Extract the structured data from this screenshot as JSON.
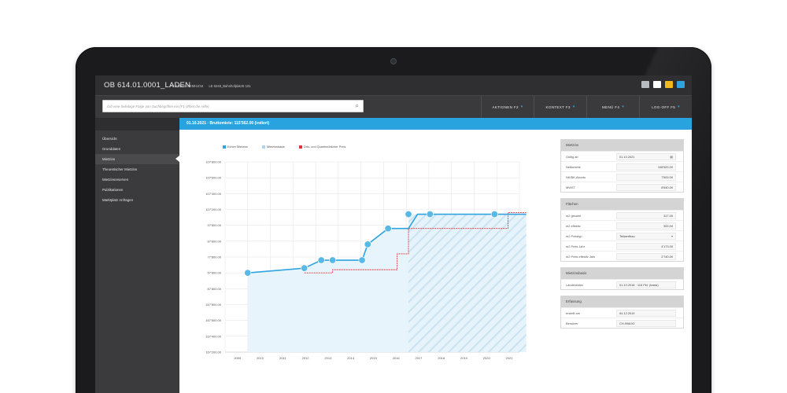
{
  "app": {
    "title": "OB 614.01.0001_LADEN",
    "meta": [
      "PE 834429 REMHJ/44",
      "LE 6248_BahnhofplatzE 101"
    ],
    "icons": [
      "mail-icon",
      "chat-icon",
      "note-icon",
      "help-icon"
    ]
  },
  "search": {
    "placeholder": "Gib eine beliebige Folge von Suchbegriffen ein (F1 öffnet die Hilfe)"
  },
  "menus": [
    {
      "label": "AKTIONEN F2"
    },
    {
      "label": "KONTEXT F3"
    },
    {
      "label": "MENÜ F4"
    },
    {
      "label": "LOG-OFF F5"
    }
  ],
  "sidebar": {
    "items": [
      {
        "label": "Übersicht"
      },
      {
        "label": "Grunddaten"
      },
      {
        "label": "Mietzins",
        "active": true
      },
      {
        "label": "Theoretischer Mietzins"
      },
      {
        "label": "Mietzinsreserven"
      },
      {
        "label": "Publikationen"
      },
      {
        "label": "Marktplatz Anfragen"
      }
    ]
  },
  "header": {
    "text": "01.10.2021 · Bruttomiete: 115'562.00 (indiert)"
  },
  "legend": [
    {
      "label": "Echter Mietzins",
      "color": "#2fa3e0"
    },
    {
      "label": "Mietzinsbasis",
      "color": "#a9d7ef"
    },
    {
      "label": "Orts- und Quartierüblicher Preis",
      "color": "#e0303a"
    }
  ],
  "chart_data": {
    "type": "line",
    "x_ticks": [
      "2009",
      "2010",
      "2011",
      "2012",
      "2013",
      "2014",
      "2015",
      "2016",
      "2017",
      "2018",
      "2019",
      "2020",
      "2021"
    ],
    "y_ticks": [
      "107'800.00",
      "107'600.00",
      "107'400.00",
      "107'200.00",
      "97'800.00",
      "87'800.00",
      "77'800.00",
      "57'800.00",
      "87'800.00",
      "167'800.00",
      "167'600.00",
      "167'400.00",
      "167'200.00"
    ],
    "ylim": [
      0,
      12
    ],
    "grid": true,
    "series": [
      {
        "name": "Echter Mietzins",
        "points": [
          [
            2009.0,
            5
          ],
          [
            2011.5,
            5.3
          ],
          [
            2012.25,
            5.8
          ],
          [
            2012.75,
            5.8
          ],
          [
            2014.05,
            5.8
          ],
          [
            2014.3,
            6.8
          ],
          [
            2015.2,
            7.8
          ],
          [
            2016.1,
            7.8
          ],
          [
            2016.5,
            8.7
          ],
          [
            2019.4,
            8.7
          ],
          [
            2021.3,
            8.7
          ]
        ],
        "markers": [
          [
            2009.0,
            5
          ],
          [
            2011.5,
            5.3
          ],
          [
            2012.25,
            5.8
          ],
          [
            2012.75,
            5.8
          ],
          [
            2014.05,
            5.8
          ],
          [
            2014.3,
            6.8
          ],
          [
            2015.2,
            7.8
          ],
          [
            2016.1,
            8.7
          ],
          [
            2017.05,
            8.7
          ],
          [
            2019.9,
            8.7
          ]
        ]
      },
      {
        "name": "Orts- und Quartierüblicher Preis",
        "points": [
          [
            2011.5,
            5.0
          ],
          [
            2012.75,
            5.0
          ],
          [
            2012.75,
            5.2
          ],
          [
            2015.6,
            5.2
          ],
          [
            2015.6,
            6.2
          ],
          [
            2016.1,
            6.2
          ],
          [
            2016.1,
            7.8
          ],
          [
            2020.5,
            7.8
          ],
          [
            2020.5,
            8.8
          ],
          [
            2021.3,
            8.8
          ]
        ]
      }
    ]
  },
  "panels": [
    {
      "title": "Mietzins",
      "rows": [
        {
          "label": "Gültig ab",
          "value": "01.10.2021",
          "icon": "calendar-icon"
        },
        {
          "label": "Nettomiete",
          "value": "108'500.00"
        },
        {
          "label": "NK/BK-Akonto",
          "value": "7'500.00"
        },
        {
          "label": "MWST",
          "value": "8'540.00"
        }
      ]
    },
    {
      "title": "Flächen",
      "rows": [
        {
          "label": "m2 gesamt",
          "value": "317.00"
        },
        {
          "label": "m2 effektiv",
          "value": "300.00"
        },
        {
          "label": "m2 Preistyp",
          "value": "Teilwertbau",
          "icon": "chevron-down-icon"
        },
        {
          "label": "m2 Preis Jahr",
          "value": "4'173.00"
        },
        {
          "label": "m2 Preis effektiv Jahr",
          "value": "2'740.00"
        }
      ]
    },
    {
      "title": "Mietzinsbasis",
      "rows": [
        {
          "label": "Landesindex",
          "value": "01.10.2018 · 116 Pkt. (basis)"
        }
      ]
    },
    {
      "title": "Erfassung",
      "rows": [
        {
          "label": "erstellt am",
          "value": "04.12.2019"
        },
        {
          "label": "Benutzer",
          "value": "CH-998/JG"
        }
      ]
    }
  ]
}
